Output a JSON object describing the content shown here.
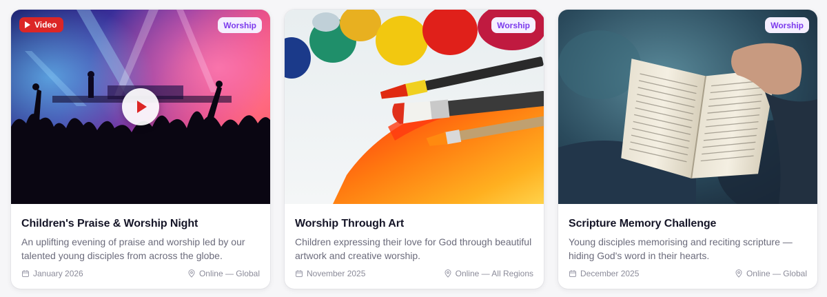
{
  "cards": [
    {
      "video_label": "Video",
      "category": "Worship",
      "title": "Children's Praise & Worship Night",
      "description": "An uplifting evening of praise and worship led by our talented young disciples from across the globe.",
      "date": "January 2026",
      "location": "Online — Global",
      "image": "concert-crowd-stage-lights"
    },
    {
      "category": "Worship",
      "title": "Worship Through Art",
      "description": "Children expressing their love for God through beautiful artwork and creative worship.",
      "date": "November 2025",
      "location": "Online — All Regions",
      "image": "paint-brushes-colorful"
    },
    {
      "category": "Worship",
      "title": "Scripture Memory Challenge",
      "description": "Young disciples memorising and reciting scripture — hiding God's word in their hearts.",
      "date": "December 2025",
      "location": "Online — Global",
      "image": "open-bible-hand"
    }
  ],
  "colors": {
    "video_badge": "#dc2626",
    "category_badge_bg": "#f5efff",
    "category_badge_text": "#7c3aed"
  }
}
